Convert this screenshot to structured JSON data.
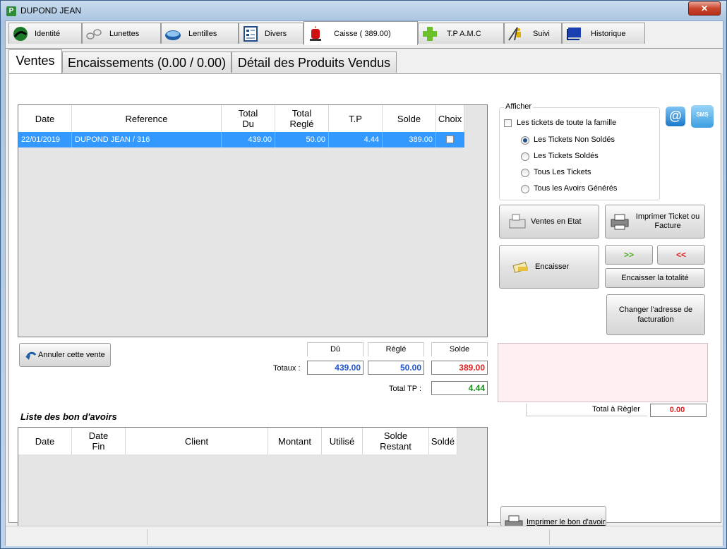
{
  "window": {
    "title": "DUPOND JEAN",
    "close_label": "✕"
  },
  "top_tabs": [
    {
      "label": "Identité",
      "icon": "identity-icon"
    },
    {
      "label": "Lunettes",
      "icon": "glasses-icon"
    },
    {
      "label": "Lentilles",
      "icon": "lens-icon"
    },
    {
      "label": "Divers",
      "icon": "form-icon"
    },
    {
      "label": "Caisse ( 389.00)",
      "icon": "red-light-icon"
    },
    {
      "label": "T.P A.M.C",
      "icon": "green-cross-icon"
    },
    {
      "label": "Suivi",
      "icon": "worker-icon"
    },
    {
      "label": "Historique",
      "icon": "book-icon"
    }
  ],
  "sub_tabs": [
    "Ventes",
    "Encaissements (0.00 / 0.00)",
    "Détail des Produits Vendus"
  ],
  "sales_grid": {
    "headers": [
      "Date",
      "Reference",
      "Total\nDu",
      "Total\nReglé",
      "T.P",
      "Solde",
      "Choix"
    ],
    "rows": [
      {
        "date": "22/01/2019",
        "reference": "DUPOND JEAN / 316",
        "total_du": "439.00",
        "total_regle": "50.00",
        "tp": "4.44",
        "solde": "389.00"
      }
    ]
  },
  "afficher": {
    "title": "Afficher",
    "family_checkbox": "Les tickets de toute la famille",
    "options": [
      "Les Tickets Non Soldés",
      "Les Tickets Soldés",
      "Tous Les Tickets",
      "Tous les Avoirs Générés"
    ],
    "selected": 0
  },
  "buttons": {
    "ventes_en_etat": "Ventes en Etat",
    "imprimer_ticket": "Imprimer Ticket ou Facture",
    "encaisser": "Encaisser",
    "forward": ">>",
    "back": "<<",
    "encaisser_totalite": "Encaisser la totalité",
    "changer_adresse": "Changer l'adresse de facturation",
    "annuler_vente": "Annuler cette vente",
    "imprimer_bon": "Imprimer le bon d'avoir"
  },
  "totals": {
    "label_totaux": "Totaux :",
    "hdr_du": "Dû",
    "hdr_regle": "Règlé",
    "hdr_solde": "Solde",
    "du": "439.00",
    "regle": "50.00",
    "solde": "389.00",
    "label_tp": "Total TP :",
    "tp": "4.44",
    "label_a_regler": "Total à Règler",
    "a_regler": "0.00"
  },
  "avoirs": {
    "title": "Liste des bon d'avoirs",
    "headers": [
      "Date",
      "Date\nFin",
      "Client",
      "Montant",
      "Utilisé",
      "Solde\nRestant",
      "Soldé"
    ]
  },
  "icons": {
    "email": "@",
    "sms": "SMS"
  },
  "colors": {
    "selection": "#3399ff",
    "du": "#2255cc",
    "solde": "#e02020",
    "tp": "#1a8a1a",
    "pink_panel": "#fdeff2"
  }
}
